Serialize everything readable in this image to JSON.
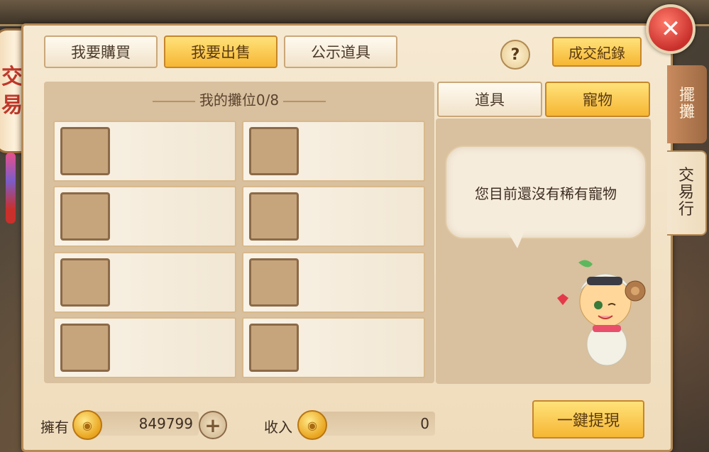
{
  "lantern": {
    "char1": "交",
    "char2": "易"
  },
  "top_buttons": {
    "buy": "我要購買",
    "sell": "我要出售",
    "public": "公示道具",
    "history": "成交紀錄",
    "help": "?"
  },
  "stall": {
    "title": "我的攤位0/8",
    "slot_count": 8
  },
  "tabs": {
    "items": "道具",
    "pets": "寵物"
  },
  "bubble_text": "您目前還沒有稀有寵物",
  "side_tabs": {
    "stall": [
      "擺",
      "攤"
    ],
    "trade": [
      "交",
      "易",
      "行"
    ]
  },
  "bottom": {
    "own_label": "擁有",
    "own_value": "849799",
    "income_label": "收入",
    "income_value": "0",
    "withdraw": "一鍵提現"
  },
  "close": "✕"
}
